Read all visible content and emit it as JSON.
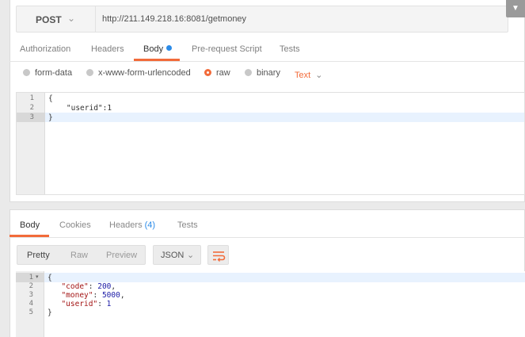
{
  "request": {
    "method": "POST",
    "url": "http://211.149.218.16:8081/getmoney",
    "tabs": [
      "Authorization",
      "Headers",
      "Body",
      "Pre-request Script",
      "Tests"
    ],
    "active_tab": "Body",
    "body_modes": [
      "form-data",
      "x-www-form-urlencoded",
      "raw",
      "binary"
    ],
    "selected_mode": "raw",
    "content_type": "Text",
    "body_lines": [
      "{",
      "    \"userid\":1",
      "}"
    ],
    "line_numbers": [
      "1",
      "2",
      "3"
    ]
  },
  "response": {
    "tabs": [
      "Body",
      "Cookies",
      "Headers",
      "Tests"
    ],
    "headers_count": "(4)",
    "active_tab": "Body",
    "view_modes": [
      "Pretty",
      "Raw",
      "Preview"
    ],
    "active_view": "Pretty",
    "format": "JSON",
    "line_numbers": [
      "1",
      "2",
      "3",
      "4",
      "5"
    ],
    "body": {
      "open": "{",
      "lines": [
        {
          "key": "\"code\"",
          "value": "200",
          "sep": ","
        },
        {
          "key": "\"money\"",
          "value": "5000",
          "sep": ","
        },
        {
          "key": "\"userid\"",
          "value": "1",
          "sep": ""
        }
      ],
      "close": "}"
    }
  },
  "colors": {
    "accent": "#f26b3a",
    "blue": "#2b8be8"
  },
  "icons": {
    "method_dropdown": "chevron-down-icon",
    "wrap": "wrap-lines-icon",
    "fold": "fold-arrow-icon"
  }
}
